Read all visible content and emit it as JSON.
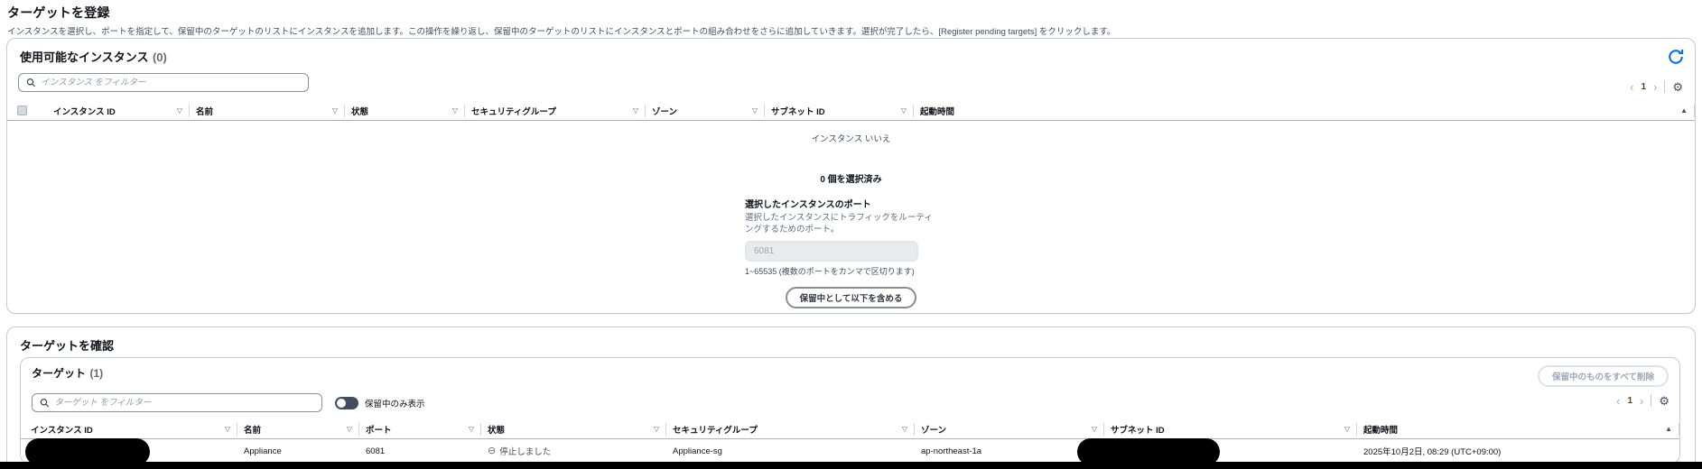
{
  "icons": {
    "sort_down": "▽",
    "sort_up": "▲",
    "prev": "‹",
    "next": "›",
    "gear": "⚙",
    "stopped": "⊖"
  },
  "page": {
    "title": "ターゲットを登録",
    "description": "インスタンスを選択し、ポートを指定して、保留中のターゲットのリストにインスタンスを追加します。この操作を繰り返し、保留中のターゲットのリストにインスタンスとポートの組み合わせをさらに追加していきます。選択が完了したら、[Register pending targets] をクリックします。"
  },
  "available": {
    "title": "使用可能なインスタンス",
    "count": "(0)",
    "filter_placeholder": "インスタンス をフィルター",
    "page_number": "1",
    "columns": [
      "インスタンス ID",
      "名前",
      "状態",
      "セキュリティグループ",
      "ゾーン",
      "サブネット ID",
      "起動時間"
    ],
    "empty_text": "インスタンス いいえ",
    "selected_summary": "0 個を選択済み",
    "port_label": "選択したインスタンスのポート",
    "port_description": "選択したインスタンスにトラフィックをルーティングするためのポート。",
    "port_value": "6081",
    "port_constraint": "1~65535 (複数のポートをカンマで区切ります)",
    "include_button": "保留中として以下を含める"
  },
  "review": {
    "title": "ターゲットを確認",
    "targets_title": "ターゲット",
    "count": "(1)",
    "filter_placeholder": "ターゲット をフィルター",
    "toggle_label": "保留中のみ表示",
    "remove_all_button": "保留中のものをすべて削除",
    "page_number": "1",
    "columns": [
      "インスタンス ID",
      "名前",
      "ポート",
      "状態",
      "セキュリティグループ",
      "ゾーン",
      "サブネット ID",
      "起動時間"
    ],
    "row": {
      "name": "Appliance",
      "port": "6081",
      "state": "停止しました",
      "security_group": "Appliance-sg",
      "zone": "ap-northeast-1a",
      "launch_time": "2025年10月2日, 08:29 (UTC+09:00)"
    }
  }
}
